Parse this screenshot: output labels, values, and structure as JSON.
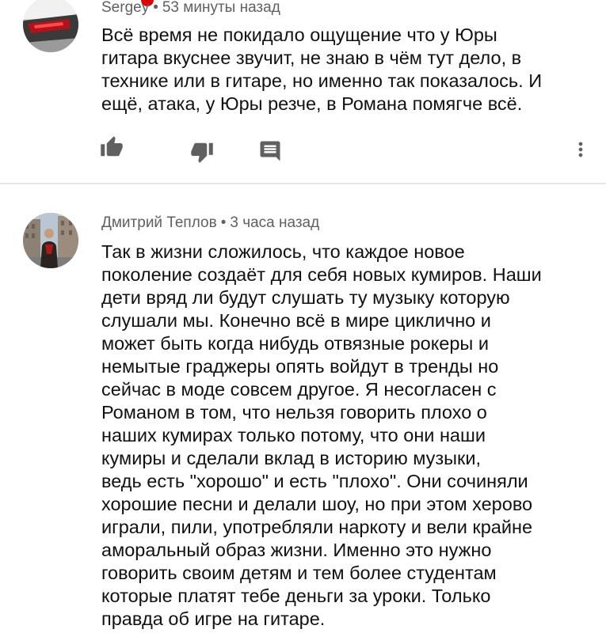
{
  "comments": [
    {
      "author": "Sergey",
      "time": "53 минуты назад",
      "lines": [
        "Всё время не покидало ощущение что у Юры",
        "гитара вкуснее звучит, не знаю в чём тут дело, в",
        "технике или в гитаре, но именно так показалось. И",
        "ещё, атака, у Юры резче, в Романа помягче всё."
      ],
      "separator": "•"
    },
    {
      "author": "Дмитрий Теплов",
      "time": "3 часа назад",
      "separator": "•",
      "lines": [
        "Так в жизни сложилось, что каждое новое",
        "поколение создаёт для себя новых кумиров. Наши",
        "дети вряд ли будут слушать ту музыку которую",
        "слушали мы. Конечно всё в мире циклично и",
        "может быть когда нибудь отвязные рокеры и",
        "немытые граджеры опять войдут в тренды но",
        "сейчас в моде совсем другое. Я несогласен с",
        "Романом в том, что нельзя говорить плохо о",
        "наших кумирах только потому, что они наши",
        "кумиры и сделали вклад в историю музыки,",
        "ведь есть \"хорошо\" и есть \"плохо\". Они сочиняли",
        "хорошие песни и делали шоу, но при этом херово",
        "играли, пили, употребляли наркоту и вели крайне",
        "аморальный образ жизни. Именно это нужно",
        "говорить своим детям и тем более студентам",
        "которые платят тебе деньги за уроки. Только",
        "правда об игре на гитаре."
      ]
    }
  ],
  "icons": {
    "like": "thumb-up-icon",
    "dislike": "thumb-down-icon",
    "reply": "comment-reply-icon",
    "more": "more-vert-icon"
  },
  "colors": {
    "meta_text": "#606060",
    "body_text": "#111111",
    "icon": "#606060",
    "divider": "#e6e6e6",
    "notification_badge": "#e00000"
  }
}
